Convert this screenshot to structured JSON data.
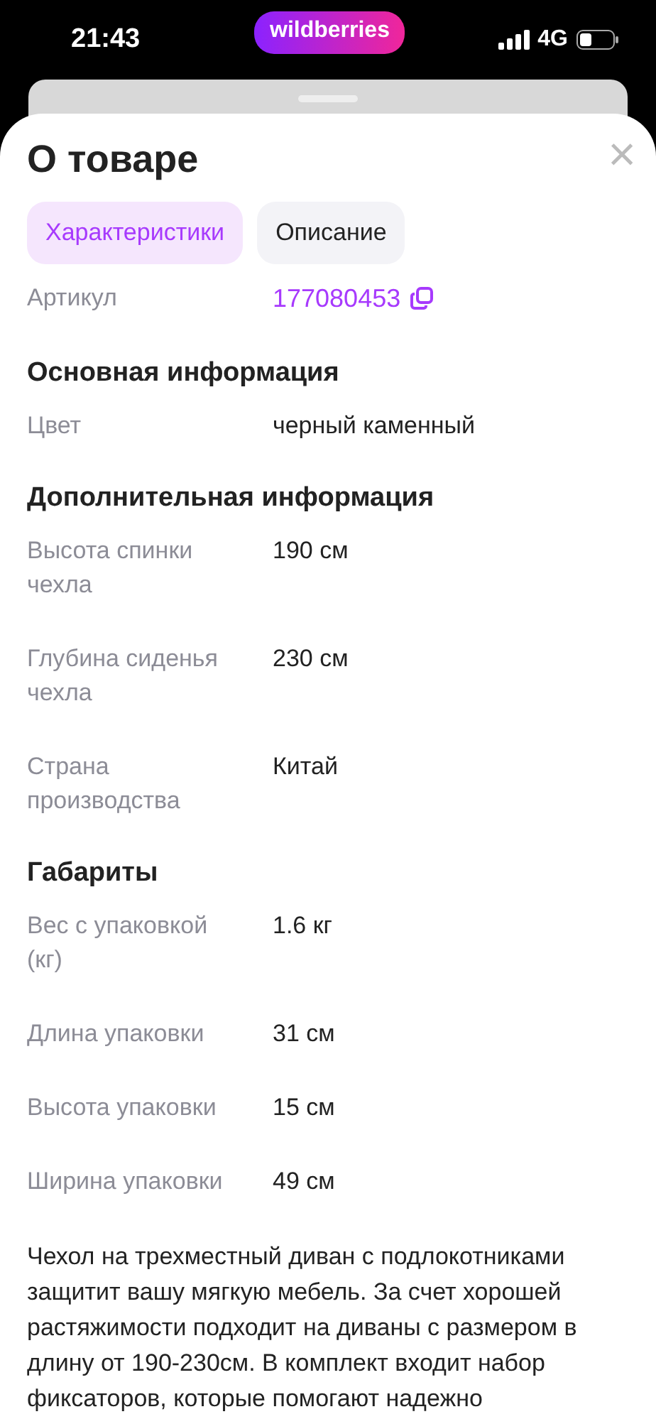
{
  "status_bar": {
    "time": "21:43",
    "app_badge": "wildberries",
    "network": "4G"
  },
  "sheet": {
    "title": "О товаре",
    "close": "×"
  },
  "tabs": [
    {
      "label": "Характеристики",
      "selected": true
    },
    {
      "label": "Описание",
      "selected": false
    }
  ],
  "article": {
    "label": "Артикул",
    "value": "177080453"
  },
  "sections": [
    {
      "title": "Основная информация",
      "rows": [
        {
          "label": "Цвет",
          "value": "черный каменный"
        }
      ]
    },
    {
      "title": "Дополнительная информация",
      "rows": [
        {
          "label": "Высота спинки чехла",
          "value": "190 см"
        },
        {
          "label": "Глубина сиденья чехла",
          "value": "230 см"
        },
        {
          "label": "Страна производства",
          "value": "Китай"
        }
      ]
    },
    {
      "title": "Габариты",
      "rows": [
        {
          "label": "Вес с упаковкой (кг)",
          "value": "1.6 кг"
        },
        {
          "label": "Длина упаковки",
          "value": "31 см"
        },
        {
          "label": "Высота упаковки",
          "value": "15 см"
        },
        {
          "label": "Ширина упаковки",
          "value": "49 см"
        }
      ]
    }
  ],
  "description": "Чехол на трехместный диван с подлокотниками защитит вашу мягкую мебель. За счет хорошей растяжимости подходит на диваны с размером в длину от 190-230см. В комплект входит набор фиксаторов, которые помогают надежно"
}
